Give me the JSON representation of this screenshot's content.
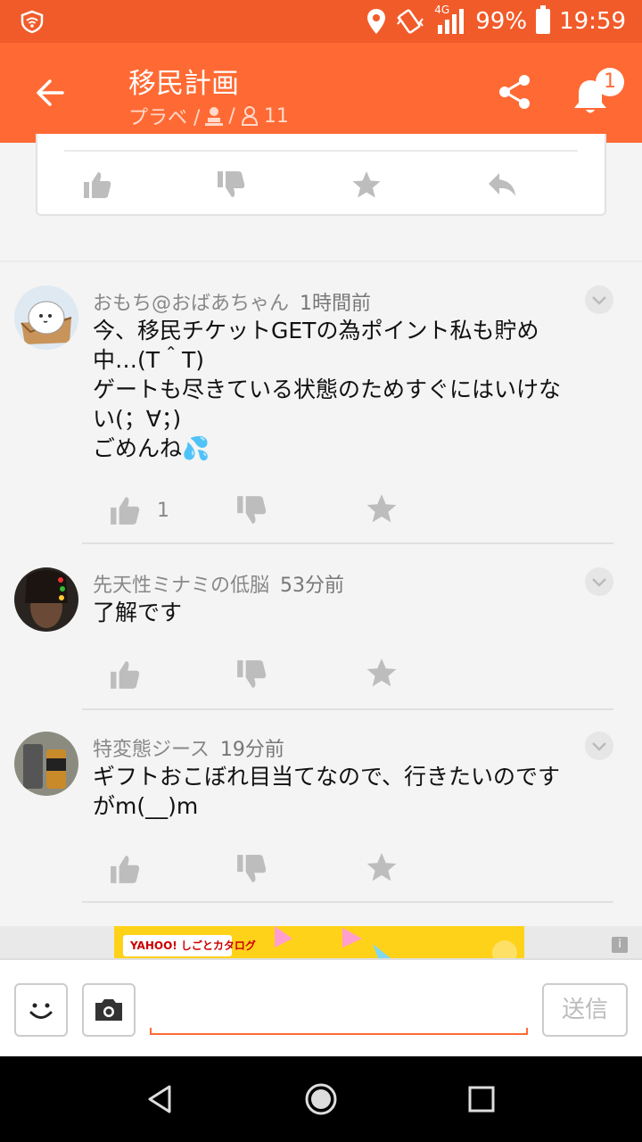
{
  "status_bar": {
    "network": "4G",
    "battery": "99%",
    "time": "19:59"
  },
  "app_bar": {
    "title": "移民計画",
    "subtitle_prefix": "プラベ /",
    "subtitle_sep": "/",
    "member_count": "11",
    "notification_count": "1"
  },
  "comments": [
    {
      "author": "おもち@おばあちゃん",
      "time": "1時間前",
      "text": "今、移民チケットGETの為ポイント私も貯め中…(T＾T)\nゲートも尽きている状態のためすぐにはいけない(；∀；)\nごめんね💦",
      "like_count": "1"
    },
    {
      "author": "先天性ミナミの低脳",
      "time": "53分前",
      "text": "了解です",
      "like_count": ""
    },
    {
      "author": "特変態ジース",
      "time": "19分前",
      "text": "ギフトおこぼれ目当てなので、行きたいのですがm(__)m",
      "like_count": ""
    }
  ],
  "ad": {
    "logo_text": "YAHOO! しごとカタログ",
    "info_label": "i"
  },
  "input_bar": {
    "send_label": "送信",
    "placeholder": ""
  },
  "colors": {
    "accent": "#ff6a34",
    "status": "#f15b2a"
  }
}
